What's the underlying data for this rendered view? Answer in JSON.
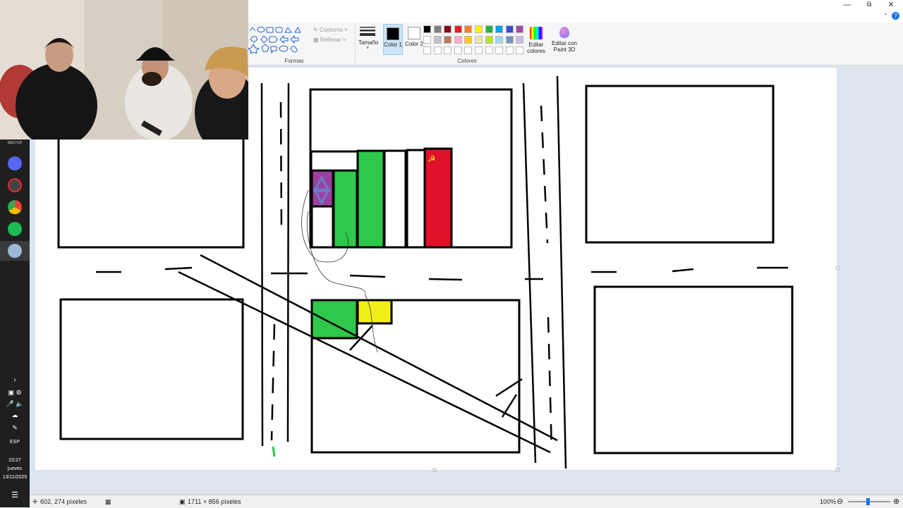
{
  "ribbon": {
    "outline_label": "Contorno",
    "fill_label": "Rellenar",
    "shapes_group": "Formas",
    "size_label": "Tamaño",
    "color1_label": "Color 1",
    "color2_label": "Color 2",
    "colors_group": "Colores",
    "edit_colors_label": "Editar colores",
    "paint3d_label": "Editar con Paint 3D",
    "palette_row1": [
      "#000000",
      "#7f7f7f",
      "#880015",
      "#ed1c24",
      "#ff7f27",
      "#fff200",
      "#22b14c",
      "#00a2e8",
      "#3f48cc",
      "#a349a4"
    ],
    "palette_row2": [
      "#ffffff",
      "#c3c3c3",
      "#b97a57",
      "#ffaec9",
      "#ffc90e",
      "#efe4b0",
      "#b5e61d",
      "#99d9ea",
      "#7092be",
      "#c8bfe7"
    ]
  },
  "taskbar": {
    "time": "23:27",
    "day": "jueves",
    "date": "13/11/2025",
    "language": "ESP",
    "app_label": "MEETER"
  },
  "statusbar": {
    "cursor_pos": "602, 274 píxeles",
    "canvas_size": "1711 × 856 píxeles",
    "zoom": "100%"
  },
  "colors": {
    "green": "#2ec84a",
    "red": "#e0102a",
    "purple": "#9b3fa0",
    "yellow": "#f2ee1a",
    "canvas_bg": "#dde4ee"
  }
}
